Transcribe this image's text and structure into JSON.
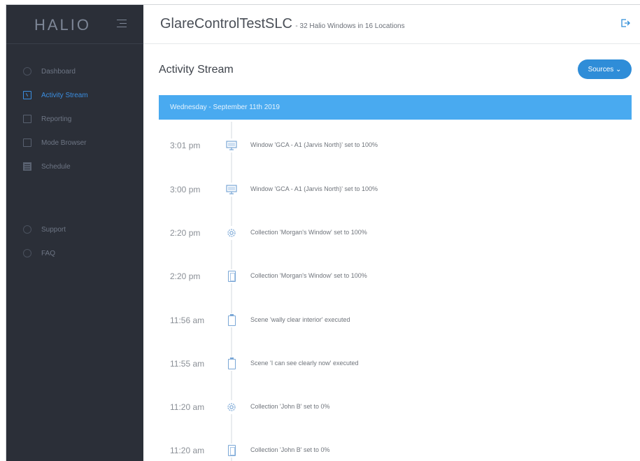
{
  "brand": {
    "logo": "HALIO"
  },
  "sidebar": {
    "items": [
      {
        "label": "Dashboard",
        "icon": "gauge-icon",
        "active": false
      },
      {
        "label": "Activity Stream",
        "icon": "activity-icon",
        "active": true
      },
      {
        "label": "Reporting",
        "icon": "clipboard-icon",
        "active": false
      },
      {
        "label": "Mode Browser",
        "icon": "window-icon",
        "active": false
      },
      {
        "label": "Schedule",
        "icon": "calendar-icon",
        "active": false
      },
      {
        "label": "Support",
        "icon": "support-icon",
        "active": false
      },
      {
        "label": "FAQ",
        "icon": "faq-icon",
        "active": false
      }
    ]
  },
  "header": {
    "title": "GlareControlTestSLC",
    "subtitle": "- 32 Halio Windows in 16 Locations",
    "logout_icon": "logout-icon"
  },
  "main": {
    "section_title": "Activity Stream",
    "sources_button": "Sources ⌄",
    "day_label": "Wednesday - September 11th 2019",
    "entries": [
      {
        "time": "3:01 pm",
        "icon": "window-icon",
        "message": "Window 'GCA - A1 (Jarvis North)' set to 100%"
      },
      {
        "time": "3:00 pm",
        "icon": "window-icon",
        "message": "Window 'GCA - A1 (Jarvis North)' set to 100%"
      },
      {
        "time": "2:20 pm",
        "icon": "gear-icon",
        "message": "Collection 'Morgan's Window' set to 100%"
      },
      {
        "time": "2:20 pm",
        "icon": "pane-icon",
        "message": "Collection 'Morgan's Window' set to 100%"
      },
      {
        "time": "11:56 am",
        "icon": "scene-icon",
        "message": "Scene 'wally clear interior' executed"
      },
      {
        "time": "11:55 am",
        "icon": "scene-icon",
        "message": "Scene 'I can see clearly now' executed"
      },
      {
        "time": "11:20 am",
        "icon": "gear-icon",
        "message": "Collection 'John B' set to 0%"
      },
      {
        "time": "11:20 am",
        "icon": "pane-icon",
        "message": "Collection 'John B' set to 0%"
      }
    ]
  },
  "colors": {
    "sidebar_bg": "#2b2f38",
    "accent": "#2f8dd8",
    "day_bar": "#49aaf0"
  }
}
